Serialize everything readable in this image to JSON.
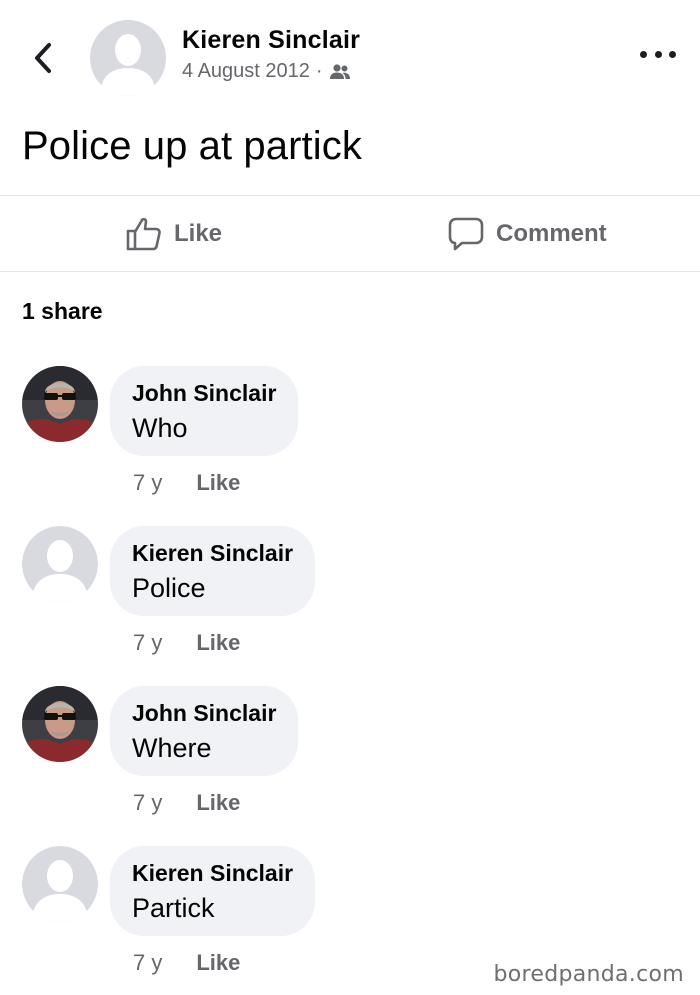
{
  "post": {
    "author": "Kieren Sinclair",
    "date": "4 August 2012",
    "separator": "·",
    "audience_icon": "friends-icon",
    "text": "Police up at partick"
  },
  "actions": {
    "like_label": "Like",
    "comment_label": "Comment"
  },
  "shares": "1 share",
  "comments": [
    {
      "name": "John Sinclair",
      "text": "Who",
      "age": "7 y",
      "like_label": "Like",
      "avatar": "photo-avatar"
    },
    {
      "name": "Kieren Sinclair",
      "text": "Police",
      "age": "7 y",
      "like_label": "Like",
      "avatar": "default-avatar"
    },
    {
      "name": "John Sinclair",
      "text": "Where",
      "age": "7 y",
      "like_label": "Like",
      "avatar": "photo-avatar"
    },
    {
      "name": "Kieren Sinclair",
      "text": "Partick",
      "age": "7 y",
      "like_label": "Like",
      "avatar": "default-avatar"
    }
  ],
  "watermark": "boredpanda.com",
  "colors": {
    "bubble_bg": "#f0f2f5",
    "secondary_text": "#65676b",
    "primary_text": "#050505",
    "divider": "#e4e6eb"
  }
}
